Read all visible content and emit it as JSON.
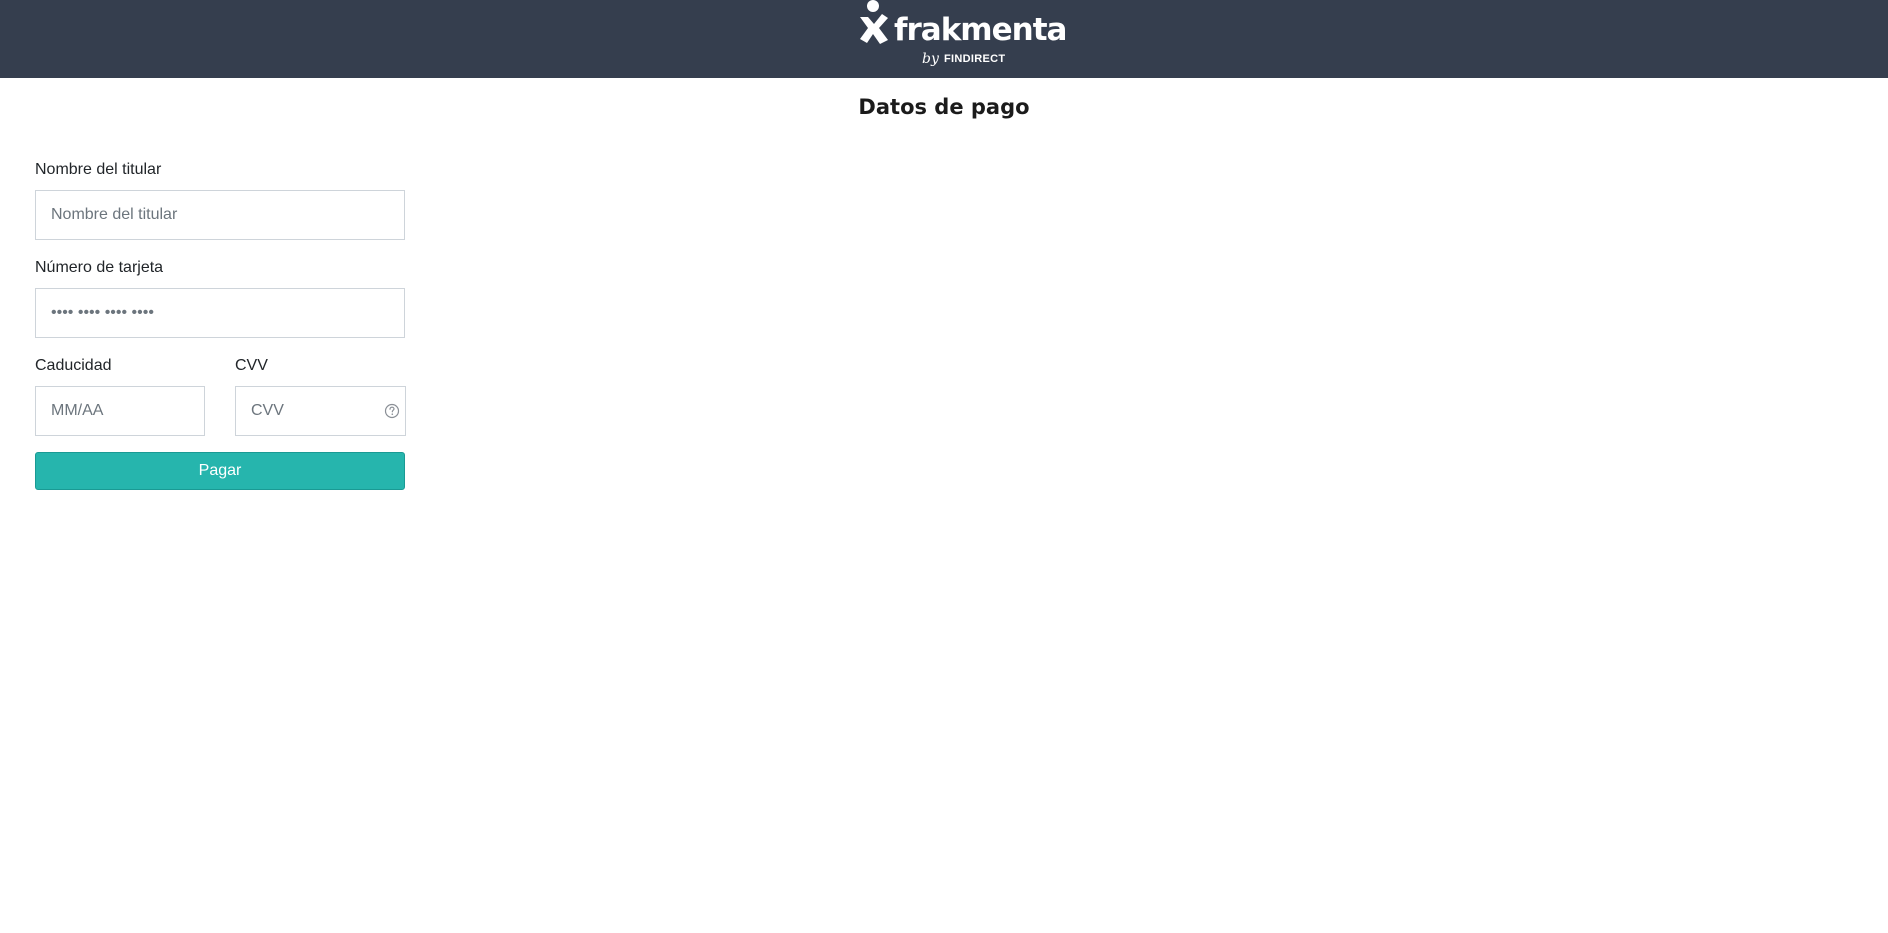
{
  "brand": {
    "name": "frakmenta",
    "by": "by",
    "sub": "FINDIRECT"
  },
  "page": {
    "title": "Datos de pago"
  },
  "form": {
    "holder": {
      "label": "Nombre del titular",
      "placeholder": "Nombre del titular",
      "value": ""
    },
    "card_number": {
      "label": "Número de tarjeta",
      "placeholder": "•••• •••• •••• ••••",
      "value": ""
    },
    "expiry": {
      "label": "Caducidad",
      "placeholder": "MM/AA",
      "value": ""
    },
    "cvv": {
      "label": "CVV",
      "placeholder": "CVV",
      "value": "",
      "help_icon": "question-circle-icon"
    },
    "submit_label": "Pagar"
  },
  "colors": {
    "header_bg": "#353e4e",
    "button_bg": "#26b5ad",
    "input_border": "#ced4da"
  }
}
